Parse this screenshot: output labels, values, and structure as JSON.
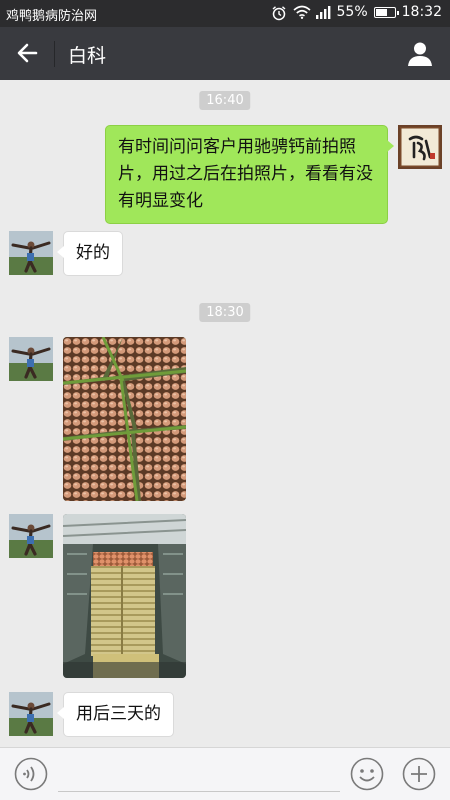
{
  "status_bar": {
    "app_title": "鸡鸭鹅病防治网",
    "battery_text": "55%",
    "battery_level": 0.55,
    "time": "18:32",
    "icons": [
      "alarm-icon",
      "wifi-icon",
      "signal-icon",
      "battery-icon"
    ]
  },
  "nav": {
    "title": "白科",
    "back_icon": "arrow-left-icon",
    "profile_icon": "person-icon"
  },
  "timestamps": [
    "16:40",
    "18:30"
  ],
  "messages": [
    {
      "side": "right",
      "type": "text",
      "text_lines": [
        "有时间问问客户用驰骋钙前拍照",
        "片，用过之后在拍照片，看看有没",
        "有明显变化"
      ]
    },
    {
      "side": "left",
      "type": "text",
      "text": "好的"
    },
    {
      "side": "left",
      "type": "image",
      "subject": "egg-trays-photo"
    },
    {
      "side": "left",
      "type": "image",
      "subject": "stacked-egg-trays-photo"
    },
    {
      "side": "left",
      "type": "text",
      "text": "用后三天的"
    }
  ],
  "input": {
    "value": "",
    "voice_icon": "voice-icon",
    "emoji_icon": "emoji-icon",
    "plus_icon": "plus-icon"
  },
  "colors": {
    "status_bar_bg": "#2c2c2e",
    "nav_bg": "#393a3f",
    "chat_bg": "#ebebeb",
    "sent_bubble": "#a0e75a",
    "received_bubble": "#ffffff",
    "timestamp_bg": "#cecece"
  }
}
